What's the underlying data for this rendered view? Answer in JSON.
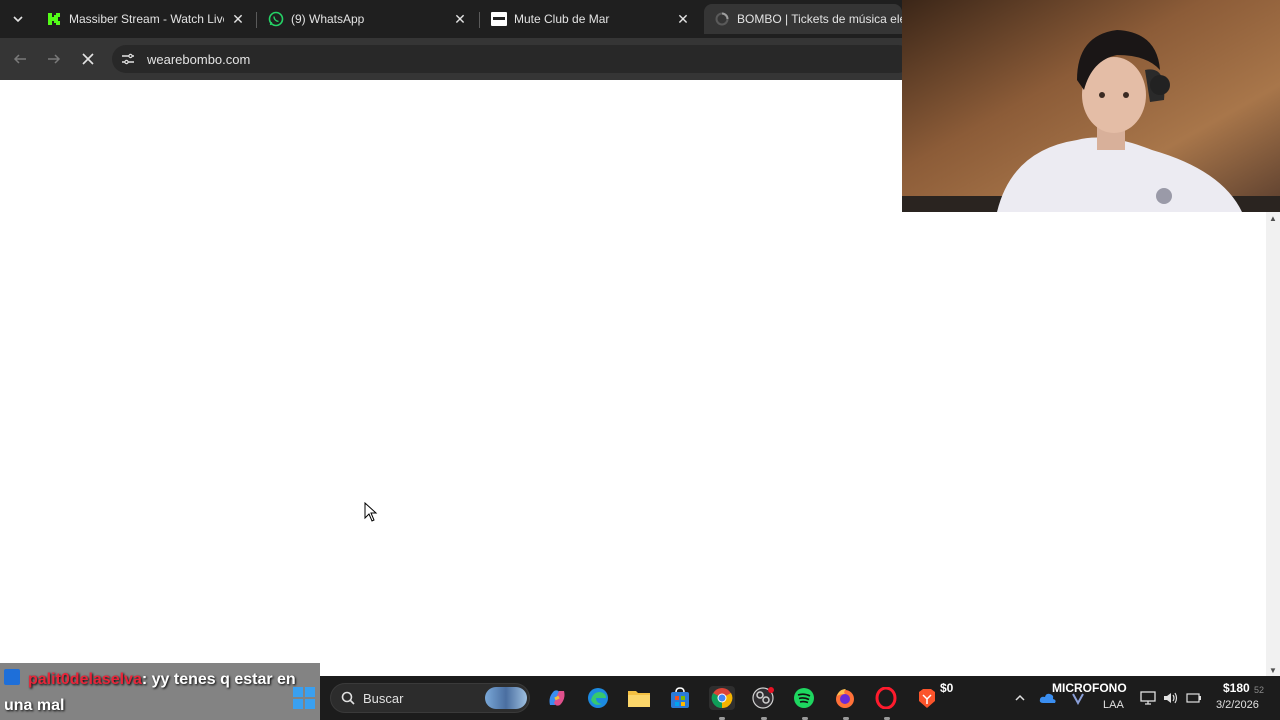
{
  "browser": {
    "tabs": [
      {
        "title": "Massiber Stream - Watch Live on Kick",
        "icon": "kick-icon",
        "color": "#53fc18"
      },
      {
        "title": "(9) WhatsApp",
        "icon": "whatsapp-icon",
        "color": "#25d366"
      },
      {
        "title": "Mute Club de Mar",
        "icon": "mute-icon",
        "color": "#ffffff"
      },
      {
        "title": "BOMBO | Tickets de música electrónica",
        "icon": "bombo-icon",
        "color": "#9e9e9e"
      }
    ],
    "url": "wearebombo.com"
  },
  "chat": {
    "username": "palit0delaselva",
    "separator": ": ",
    "message": "yy tenes q estar en una mal"
  },
  "taskbar": {
    "search_placeholder": "Buscar",
    "tray": {
      "widget_amount": "$0",
      "mic_label": "MICROFONO",
      "lang": "LAA",
      "money": "$180",
      "clock_seconds": "52",
      "date": "3/2/2026"
    }
  },
  "colors": {
    "tabbar": "#1f1f1f",
    "toolbar": "#353535",
    "chat_user": "#e8263a"
  }
}
